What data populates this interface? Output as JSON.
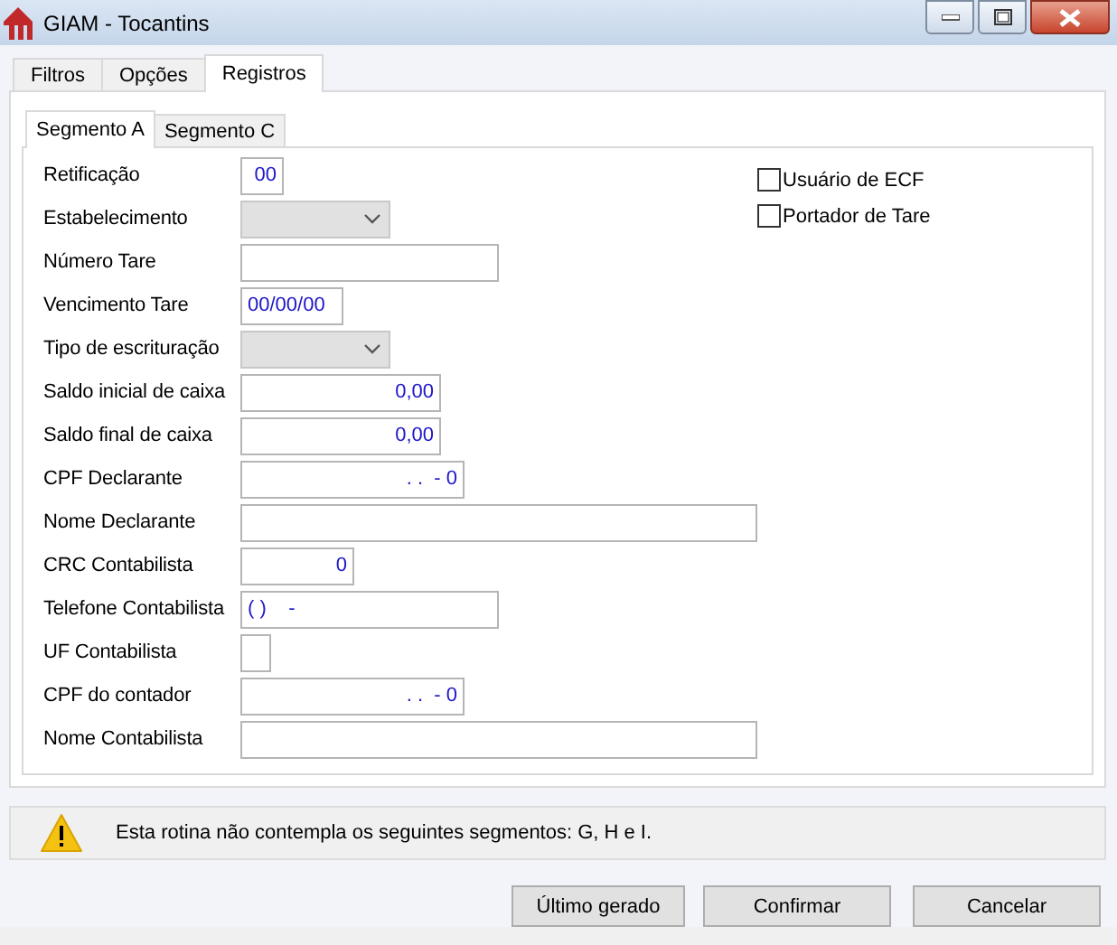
{
  "window": {
    "title": "GIAM - Tocantins"
  },
  "tabs": [
    {
      "label": "Filtros",
      "selected": false
    },
    {
      "label": "Opções",
      "selected": false
    },
    {
      "label": "Registros",
      "selected": true
    }
  ],
  "subtabs": [
    {
      "label": "Segmento A",
      "selected": true
    },
    {
      "label": "Segmento C",
      "selected": false
    }
  ],
  "fields": [
    {
      "label": "Retificação",
      "kind": "number",
      "value": "00"
    },
    {
      "label": "Estabelecimento",
      "kind": "combo"
    },
    {
      "label": "Número Tare",
      "kind": "text"
    },
    {
      "label": "Vencimento Tare",
      "kind": "text",
      "value": "00/00/00"
    },
    {
      "label": "Tipo de escrituração",
      "kind": "combo"
    },
    {
      "label": "Saldo inicial de caixa",
      "kind": "number",
      "value": "0,00"
    },
    {
      "label": "Saldo final de caixa",
      "kind": "number",
      "value": "0,00"
    },
    {
      "label": "CPF Declarante",
      "kind": "number",
      "value": ". .  - 0"
    },
    {
      "label": "Nome Declarante",
      "kind": "text"
    },
    {
      "label": "CRC Contabilista",
      "kind": "number",
      "value": "0"
    },
    {
      "label": "Telefone Contabilista",
      "kind": "text",
      "value": "( )    -"
    },
    {
      "label": "UF Contabilista",
      "kind": "text"
    },
    {
      "label": "CPF do contador",
      "kind": "number",
      "value": ". .  - 0"
    },
    {
      "label": "Nome Contabilista",
      "kind": "text"
    }
  ],
  "checkboxes": [
    {
      "label": "Usuário de ECF",
      "checked": false
    },
    {
      "label": "Portador de Tare",
      "checked": false
    }
  ],
  "message": "Esta rotina não contempla os seguintes segmentos: G, H e I.",
  "buttons": [
    "Último gerado",
    "Confirmar",
    "Cancelar"
  ]
}
